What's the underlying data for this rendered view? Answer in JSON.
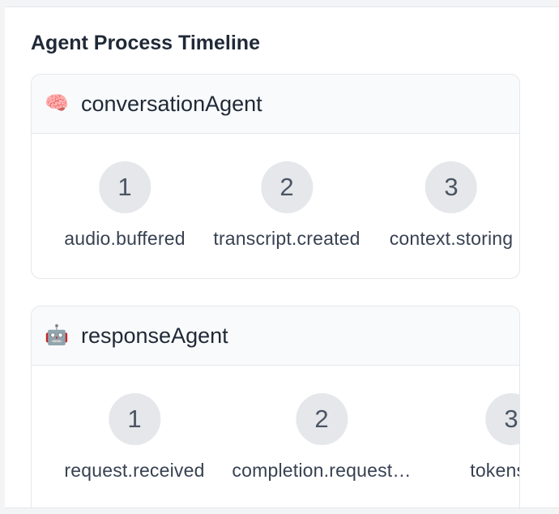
{
  "panel": {
    "title": "Agent Process Timeline"
  },
  "agents": [
    {
      "icon": "🧠",
      "icon_name": "brain-icon",
      "name": "conversationAgent",
      "steps": [
        {
          "number": "1",
          "label": "audio.buffered"
        },
        {
          "number": "2",
          "label": "transcript.created"
        },
        {
          "number": "3",
          "label": "context.storing"
        }
      ]
    },
    {
      "icon": "🤖",
      "icon_name": "robot-icon",
      "name": "responseAgent",
      "steps": [
        {
          "number": "1",
          "label": "request.received"
        },
        {
          "number": "2",
          "label": "completion.request…"
        },
        {
          "number": "3",
          "label": "tokens.ge"
        }
      ]
    }
  ]
}
